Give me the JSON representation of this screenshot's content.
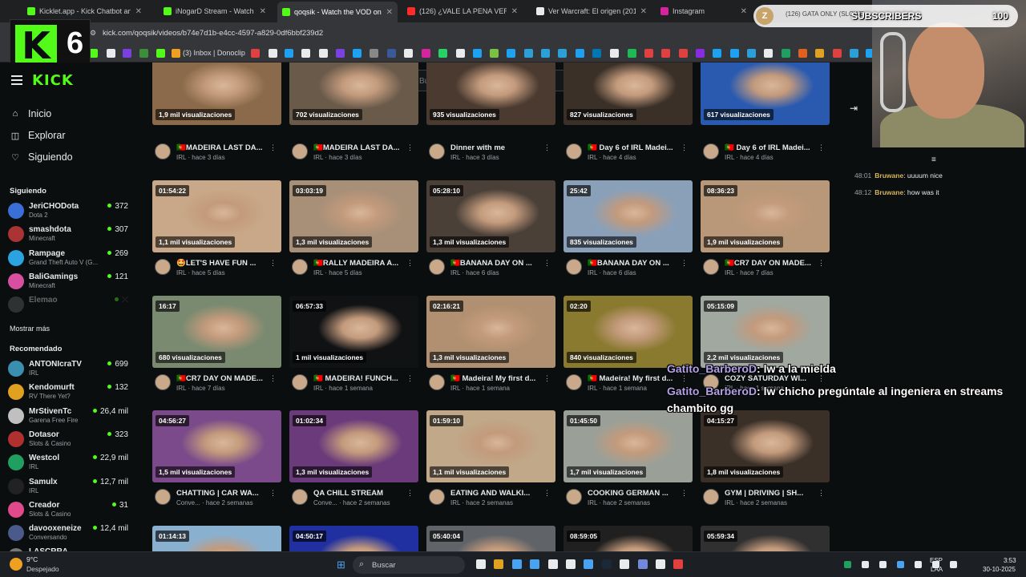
{
  "browser": {
    "tabs": [
      {
        "title": "Kicklet.app - Kick Chatbot and I",
        "color": "#53fc18"
      },
      {
        "title": "iNogarD Stream - Watch Live o",
        "color": "#53fc18"
      },
      {
        "title": "qoqsik - Watch the VOD on Ki",
        "color": "#53fc18",
        "active": true
      },
      {
        "title": "(126) ¿VALE LA PENA VER GINT",
        "color": "#ff2a2a"
      },
      {
        "title": "Ver Warcraft: El origen (2016) C",
        "color": "#e8eaec",
        "glyph": "P"
      },
      {
        "title": "Instagram",
        "color": "#d6249f"
      }
    ],
    "url": "kick.com/qoqsik/videos/b74e7d1b-e4cc-4597-a829-0df6bbf239d2",
    "bookmark_label": "(3) Inbox | Donoclip"
  },
  "overlay": {
    "badge_number": "6",
    "subs_title": "(126) GATA ONLY (SLOWE",
    "subs_label": "SUBSCRIBERS",
    "subs_count": "100",
    "subs_avatar": "Z"
  },
  "kick": {
    "logo": "KICK",
    "search_placeholder": "Buscar",
    "nav": [
      {
        "label": "Inicio",
        "icon": "home-icon",
        "glyph": "⌂"
      },
      {
        "label": "Explorar",
        "icon": "compass-icon",
        "glyph": "◫"
      },
      {
        "label": "Siguiendo",
        "icon": "heart-icon",
        "glyph": "♡"
      }
    ],
    "following_title": "Siguiendo",
    "following": [
      {
        "name": "JeriCHODota",
        "game": "Dota 2",
        "viewers": "372",
        "color": "#3b6fd8"
      },
      {
        "name": "smashdota",
        "game": "Minecraft",
        "viewers": "307",
        "color": "#a33"
      },
      {
        "name": "Rampage",
        "game": "Grand Theft Auto V (G...",
        "viewers": "269",
        "color": "#2aa3e0"
      },
      {
        "name": "BaliGamings",
        "game": "Minecraft",
        "viewers": "121",
        "color": "#d84fa0"
      },
      {
        "name": "Elemao",
        "game": "",
        "viewers": "",
        "color": "#666",
        "offline": true
      }
    ],
    "show_more": "Mostrar más",
    "recommended_title": "Recomendado",
    "recommended": [
      {
        "name": "ANTONIcraTV",
        "game": "IRL",
        "viewers": "699",
        "color": "#3a8fb0"
      },
      {
        "name": "Kendomurft",
        "game": "RV There Yet?",
        "viewers": "132",
        "color": "#e0a020"
      },
      {
        "name": "MrStivenTc",
        "game": "Garena Free Fire",
        "viewers": "26,4 mil",
        "color": "#c0c0c0"
      },
      {
        "name": "Dotasor",
        "game": "Slots & Casino",
        "viewers": "323",
        "color": "#b03030"
      },
      {
        "name": "Westcol",
        "game": "IRL",
        "viewers": "22,9 mil",
        "color": "#1fa060"
      },
      {
        "name": "Samulx",
        "game": "IRL",
        "viewers": "12,7 mil",
        "color": "#222"
      },
      {
        "name": "Creador",
        "game": "Slots & Casino",
        "viewers": "31",
        "color": "#e04a8a"
      },
      {
        "name": "davooxeneize",
        "game": "Conversando",
        "viewers": "12,4 mil",
        "color": "#4a5a8a"
      },
      {
        "name": "LASCRRA",
        "game": "",
        "viewers": "",
        "color": "#777"
      }
    ],
    "videos": [
      {
        "dur": "",
        "views": "1,9 mil visualizaciones",
        "title": "🇵🇹MADEIRA LAST DA...",
        "cat": "IRL",
        "ago": "hace 3 días",
        "bg": "#8a6a4a"
      },
      {
        "dur": "",
        "views": "702 visualizaciones",
        "title": "🇵🇹MADEIRA LAST DA...",
        "cat": "IRL",
        "ago": "hace 3 días",
        "bg": "#6a5a4a"
      },
      {
        "dur": "",
        "views": "935 visualizaciones",
        "title": "Dinner with me",
        "cat": "IRL",
        "ago": "hace 3 días",
        "bg": "#4a3a30"
      },
      {
        "dur": "",
        "views": "827 visualizaciones",
        "title": "🇵🇹 Day 6 of IRL Madei...",
        "cat": "IRL",
        "ago": "hace 4 días",
        "bg": "#3a3028"
      },
      {
        "dur": "",
        "views": "617 visualizaciones",
        "title": "🇵🇹 Day 6 of IRL Madei...",
        "cat": "IRL",
        "ago": "hace 4 días",
        "bg": "#2a5ab0"
      },
      {
        "dur": "01:54:22",
        "views": "1,1 mil visualizaciones",
        "title": "🤩LET'S HAVE FUN ...",
        "cat": "IRL",
        "ago": "hace 5 días",
        "bg": "#c8a888"
      },
      {
        "dur": "03:03:19",
        "views": "1,3 mil visualizaciones",
        "title": "🇵🇹RALLY MADEIRA A...",
        "cat": "IRL",
        "ago": "hace 5 días",
        "bg": "#a89078"
      },
      {
        "dur": "05:28:10",
        "views": "1,3 mil visualizaciones",
        "title": "🇵🇹BANANA DAY ON ...",
        "cat": "IRL",
        "ago": "hace 6 días",
        "bg": "#4a4038"
      },
      {
        "dur": "25:42",
        "views": "835 visualizaciones",
        "title": "🇵🇹BANANA DAY ON ...",
        "cat": "IRL",
        "ago": "hace 6 días",
        "bg": "#8aa0b8"
      },
      {
        "dur": "08:36:23",
        "views": "1,9 mil visualizaciones",
        "title": "🇵🇹CR7 DAY ON MADE...",
        "cat": "IRL",
        "ago": "hace 7 días",
        "bg": "#b89878"
      },
      {
        "dur": "16:17",
        "views": "680 visualizaciones",
        "title": "🇵🇹CR7 DAY ON MADE...",
        "cat": "IRL",
        "ago": "hace 7 días",
        "bg": "#7a8a70"
      },
      {
        "dur": "06:57:33",
        "views": "1 mil visualizaciones",
        "title": "🇵🇹 MADEIRA! FUNCH...",
        "cat": "IRL",
        "ago": "hace 1 semana",
        "bg": "#101214"
      },
      {
        "dur": "02:16:21",
        "views": "1,3 mil visualizaciones",
        "title": "🇵🇹 Madeira! My first d...",
        "cat": "IRL",
        "ago": "hace 1 semana",
        "bg": "#b09070"
      },
      {
        "dur": "02:20",
        "views": "840 visualizaciones",
        "title": "🇵🇹 Madeira! My first d...",
        "cat": "IRL",
        "ago": "hace 1 semana",
        "bg": "#8a7a30"
      },
      {
        "dur": "05:15:09",
        "views": "2,2 mil visualizaciones",
        "title": "COZY SATURDAY WI...",
        "cat": "IRL",
        "ago": "hace 1 semana",
        "bg": "#a0a8a0"
      },
      {
        "dur": "04:56:27",
        "views": "1,5 mil visualizaciones",
        "title": "CHATTING | CAR WA...",
        "cat": "Conve...",
        "ago": "hace 2 semanas",
        "bg": "#7a4a8a"
      },
      {
        "dur": "01:02:34",
        "views": "1,3 mil visualizaciones",
        "title": "QA CHILL STREAM",
        "cat": "Conve...",
        "ago": "hace 2 semanas",
        "bg": "#6a3a7a"
      },
      {
        "dur": "01:59:10",
        "views": "1,1 mil visualizaciones",
        "title": "EATING AND WALKI...",
        "cat": "IRL",
        "ago": "hace 2 semanas",
        "bg": "#c0a888"
      },
      {
        "dur": "01:45:50",
        "views": "1,7 mil visualizaciones",
        "title": "COOKING GERMAN ...",
        "cat": "IRL",
        "ago": "hace 2 semanas",
        "bg": "#9aa098"
      },
      {
        "dur": "04:15:27",
        "views": "1,8 mil visualizaciones",
        "title": "GYM | DRIVING | SH...",
        "cat": "IRL",
        "ago": "hace 2 semanas",
        "bg": "#3a3028"
      },
      {
        "dur": "01:14:13",
        "views": "",
        "title": "",
        "cat": "",
        "ago": "",
        "bg": "#8ab0d0"
      },
      {
        "dur": "04:50:17",
        "views": "",
        "title": "",
        "cat": "",
        "ago": "",
        "bg": "#2030a0"
      },
      {
        "dur": "05:40:04",
        "views": "",
        "title": "",
        "cat": "",
        "ago": "",
        "bg": "#606468"
      },
      {
        "dur": "08:59:05",
        "views": "",
        "title": "",
        "cat": "",
        "ago": "",
        "bg": "#202020"
      },
      {
        "dur": "05:59:34",
        "views": "",
        "title": "",
        "cat": "",
        "ago": "",
        "bg": "#303030"
      }
    ]
  },
  "chat": [
    {
      "time": "48:01",
      "user": "Bruwane",
      "text": "uuuum nice"
    },
    {
      "time": "48:12",
      "user": "Bruwane",
      "text": "how was it"
    }
  ],
  "overlay_chat": [
    {
      "user": "Gatito_BarberoD",
      "text": ": lw a la mielda"
    },
    {
      "user": "Gatito_BarberoD",
      "text": ": lw chicho pregúntale al ingeniera en streams"
    },
    {
      "user": "",
      "text": "chambito gg"
    }
  ],
  "taskbar": {
    "temp": "9°C",
    "weather": "Despejado",
    "search": "Buscar",
    "lang": "ESP",
    "region": "LAA",
    "time": "3:53",
    "date": "30-10-2025"
  }
}
